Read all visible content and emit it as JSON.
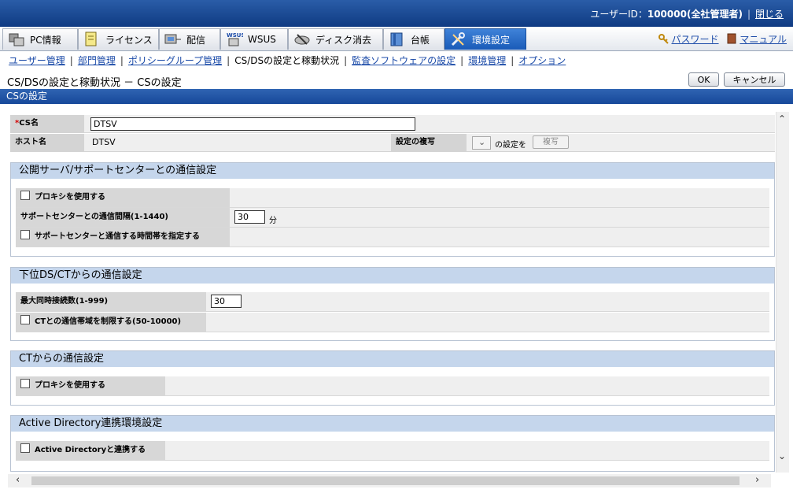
{
  "topbar": {
    "user_label": "ユーザーID：",
    "user_value": "100000(全社管理者)",
    "sep": "|",
    "close": "閉じる"
  },
  "tabs": [
    {
      "label": "PC情報",
      "icon": "pc-icon"
    },
    {
      "label": "ライセンス",
      "icon": "license-icon"
    },
    {
      "label": "配信",
      "icon": "distribution-icon"
    },
    {
      "label": "WSUS",
      "icon": "wsus-icon"
    },
    {
      "label": "ディスク消去",
      "icon": "disk-erase-icon"
    },
    {
      "label": "台帳",
      "icon": "ledger-icon"
    },
    {
      "label": "環境設定",
      "icon": "settings-icon"
    }
  ],
  "tablinks": {
    "password": "パスワード",
    "manual": "マニュアル"
  },
  "subnav": {
    "users": "ユーザー管理",
    "dept": "部門管理",
    "policy": "ポリシーグループ管理",
    "current": "CS/DSの設定と稼動状況",
    "audit": "監査ソフトウェアの設定",
    "env": "環境管理",
    "option": "オプション",
    "bar": "|"
  },
  "page": {
    "title": "CS/DSの設定と稼動状況 － CSの設定",
    "ok": "OK",
    "cancel": "キャンセル",
    "section": "CSの設定"
  },
  "cs": {
    "name_req": "*",
    "name_label": "CS名",
    "name_value": "DTSV",
    "host_label": "ホスト名",
    "host_value": "DTSV",
    "copy_label": "設定の複写",
    "copy_suffix": "の設定を",
    "copy_button": "複写"
  },
  "public": {
    "title": "公開サーバ/サポートセンターとの通信設定",
    "proxy": "プロキシを使用する",
    "interval_label": "サポートセンターとの通信間隔(1-1440)",
    "interval_value": "30",
    "interval_unit": "分",
    "timeband": "サポートセンターと通信する時間帯を指定する"
  },
  "lower": {
    "title": "下位DS/CTからの通信設定",
    "max_label": "最大同時接続数(1-999)",
    "max_value": "30",
    "bandwidth": "CTとの通信帯域を制限する(50-10000)"
  },
  "ct": {
    "title": "CTからの通信設定",
    "proxy": "プロキシを使用する"
  },
  "ad": {
    "title": "Active Directory連携環境設定",
    "link": "Active Directoryと連携する"
  }
}
